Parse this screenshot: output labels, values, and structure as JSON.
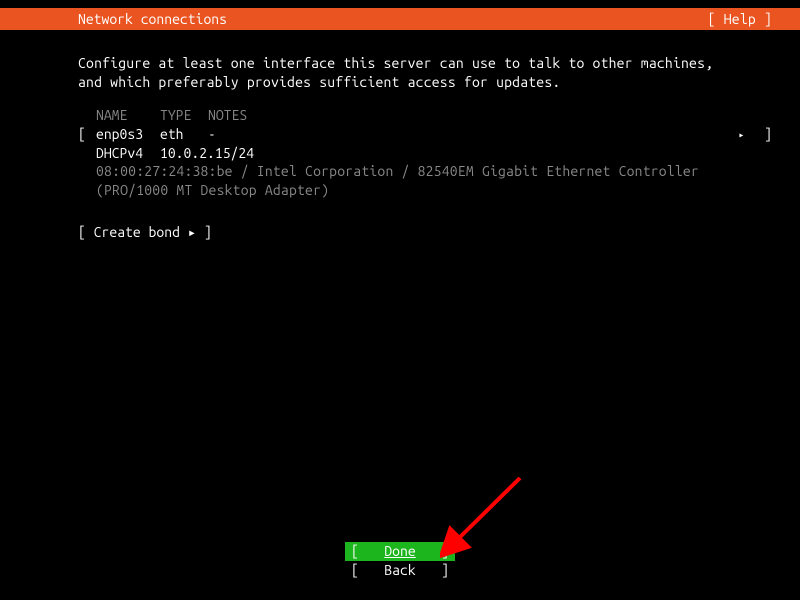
{
  "header": {
    "title": "Network connections",
    "help_label": "[ Help ]"
  },
  "description": "Configure at least one interface this server can use to talk to other machines,\nand which preferably provides sufficient access for updates.",
  "interfaces": {
    "columns": {
      "name": "NAME",
      "type": "TYPE",
      "notes": "NOTES"
    },
    "rows": [
      {
        "name": "enp0s3",
        "type": "eth",
        "notes": "-"
      }
    ],
    "dhcp_line": {
      "label": "DHCPv4",
      "ip": "10.0.2.15/24"
    },
    "details": "08:00:27:24:38:be / Intel Corporation / 82540EM Gigabit Ethernet Controller\n(PRO/1000 MT Desktop Adapter)"
  },
  "bond": {
    "label": "[ Create bond ▸ ]"
  },
  "footer": {
    "done_label": "Done",
    "back_label": "Back"
  },
  "arrow_glyph": "▸"
}
